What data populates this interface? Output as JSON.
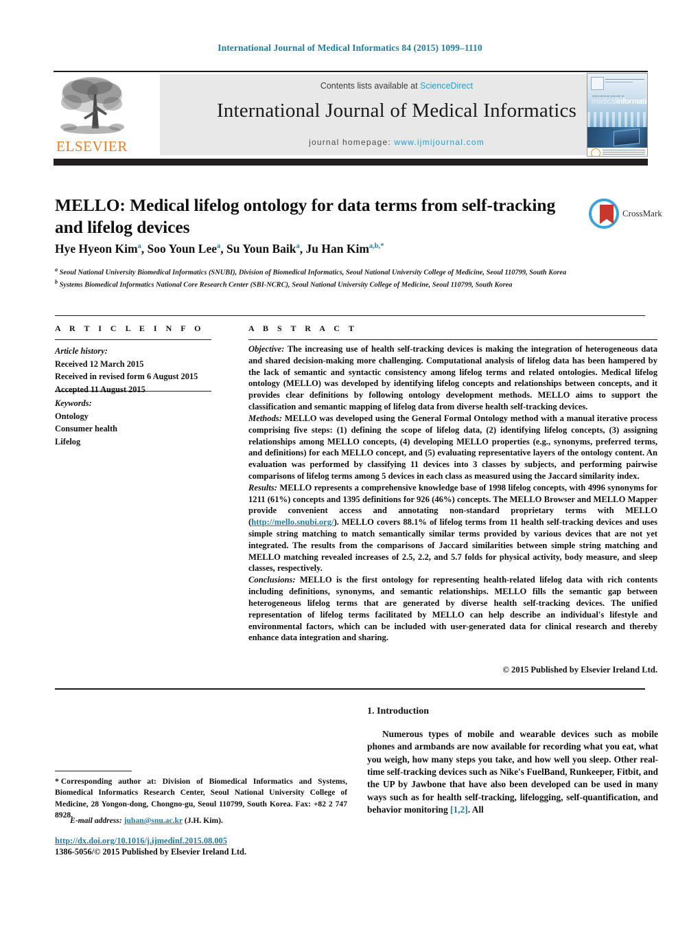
{
  "running_head": "International Journal of Medical Informatics 84 (2015) 1099–1110",
  "masthead": {
    "contents_prefix": "Contents lists available at ",
    "sciencedirect": "ScienceDirect",
    "journal_name": "International Journal of Medical Informatics",
    "homepage_prefix": "journal homepage: ",
    "homepage_url": "www.ijmijournal.com",
    "publisher_wordmark": "ELSEVIER",
    "cover": {
      "title_small": "international journal of",
      "title_main_light": "medical",
      "title_main_bold": "informatics"
    }
  },
  "article": {
    "title": "MELLO: Medical lifelog ontology for data terms from self-tracking and lifelog devices",
    "crossmark_label": "CrossMark",
    "authors_html": "Hye Hyeon Kim<sup>a</sup>, Soo Youn Lee<sup>a</sup>, Su Youn Baik<sup>a</sup>, Ju Han Kim<sup>a,b,*</sup>",
    "affiliation_a": "Seoul National University Biomedical Informatics (SNUBI), Division of Biomedical Informatics, Seoul National University College of Medicine, Seoul 110799, South Korea",
    "affiliation_b": "Systems Biomedical Informatics National Core Research Center (SBI-NCRC), Seoul National University College of Medicine, Seoul 110799, South Korea"
  },
  "article_info": {
    "heading": "A R T I C L E   I N F O",
    "history_label": "Article history:",
    "history": [
      "Received 12 March 2015",
      "Received in revised form 6 August 2015",
      "Accepted 11 August 2015"
    ],
    "keywords_label": "Keywords:",
    "keywords": [
      "Ontology",
      "Consumer health",
      "Lifelog"
    ]
  },
  "abstract": {
    "heading": "A B S T R A C T",
    "objective_label": "Objective:",
    "objective_text": " The increasing use of health self-tracking devices is making the integration of heterogeneous data and shared decision-making more challenging. Computational analysis of lifelog data has been hampered by the lack of semantic and syntactic consistency among lifelog terms and related ontologies. Medical lifelog ontology (MELLO) was developed by identifying lifelog concepts and relationships between concepts, and it provides clear definitions by following ontology development methods. MELLO aims to support the classification and semantic mapping of lifelog data from diverse health self-tracking devices.",
    "methods_label": "Methods:",
    "methods_text": " MELLO was developed using the General Formal Ontology method with a manual iterative process comprising five steps: (1) defining the scope of lifelog data, (2) identifying lifelog concepts, (3) assigning relationships among MELLO concepts, (4) developing MELLO properties (e.g., synonyms, preferred terms, and definitions) for each MELLO concept, and (5) evaluating representative layers of the ontology content. An evaluation was performed by classifying 11 devices into 3 classes by subjects, and performing pairwise comparisons of lifelog terms among 5 devices in each class as measured using the Jaccard similarity index.",
    "results_label": "Results:",
    "results_text_1": " MELLO represents a comprehensive knowledge base of 1998 lifelog concepts, with 4996 synonyms for 1211 (61%) concepts and 1395 definitions for 926 (46%) concepts. The MELLO Browser and MELLO Mapper provide convenient access and annotating non-standard proprietary terms with MELLO (",
    "results_link": "http://mello.snubi.org/",
    "results_text_2": "). MELLO covers 88.1% of lifelog terms from 11 health self-tracking devices and uses simple string matching to match semantically similar terms provided by various devices that are not yet integrated. The results from the comparisons of Jaccard similarities between simple string matching and MELLO matching revealed increases of 2.5, 2.2, and 5.7 folds for physical activity, body measure, and sleep classes, respectively.",
    "conclusions_label": "Conclusions:",
    "conclusions_text": " MELLO is the first ontology for representing health-related lifelog data with rich contents including definitions, synonyms, and semantic relationships. MELLO fills the semantic gap between heterogeneous lifelog terms that are generated by diverse health self-tracking devices. The unified representation of lifelog terms facilitated by MELLO can help describe an individual's lifestyle and environmental factors, which can be included with user-generated data for clinical research and thereby enhance data integration and sharing.",
    "copyright": "© 2015 Published by Elsevier Ireland Ltd."
  },
  "introduction": {
    "heading": "1.  Introduction",
    "para_1": "Numerous types of mobile and wearable devices such as mobile phones and armbands are now available for recording what you eat, what you weigh, how many steps you take, and how well you sleep. Other real-time self-tracking devices such as Nike's FuelBand, Runkeeper, Fitbit, and the UP by Jawbone that have also been developed can be used in many ways such as for health self-tracking, lifelogging, self-quantification, and behavior monitoring ",
    "para_1_ref": "[1,2]",
    "para_1_end": ". All"
  },
  "footer": {
    "corresponding_star": "*",
    "corresponding_text": "Corresponding author at: Division of Biomedical Informatics and Systems, Biomedical Informatics Research Center, Seoul National University College of Medicine, 28 Yongon-dong, Chongno-gu, Seoul 110799, South Korea. Fax: +82 2 747 8928.",
    "email_label": "E-mail address:",
    "email_address": "juhan@snu.ac.kr",
    "email_owner": "(J.H. Kim).",
    "doi": "http://dx.doi.org/10.1016/j.ijmedinf.2015.08.005",
    "issn": "1386-5056/© 2015 Published by Elsevier Ireland Ltd."
  }
}
